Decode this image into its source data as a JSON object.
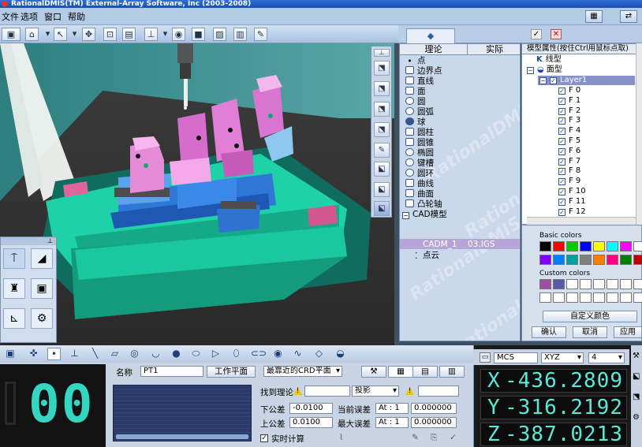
{
  "window": {
    "title": "RationalDMIS(TM) External-Array Software, Inc (2003-2008)"
  },
  "menu": {
    "items": [
      "文件",
      "选项",
      "窗口",
      "帮助"
    ]
  },
  "side_tab": {
    "label": "…"
  },
  "feature_tree": {
    "columns": [
      "理论",
      "实际"
    ],
    "items": [
      {
        "label": "点",
        "icon": "point-icon"
      },
      {
        "label": "边界点",
        "icon": "edge-point-icon"
      },
      {
        "label": "直线",
        "icon": "line-icon"
      },
      {
        "label": "面",
        "icon": "plane-icon"
      },
      {
        "label": "圆",
        "icon": "circle-icon"
      },
      {
        "label": "圆弧",
        "icon": "arc-icon"
      },
      {
        "label": "球",
        "icon": "sphere-icon"
      },
      {
        "label": "圆柱",
        "icon": "cylinder-icon"
      },
      {
        "label": "圆锥",
        "icon": "cone-icon"
      },
      {
        "label": "椭圆",
        "icon": "ellipse-icon"
      },
      {
        "label": "键槽",
        "icon": "slot-icon"
      },
      {
        "label": "圆环",
        "icon": "torus-icon"
      },
      {
        "label": "曲线",
        "icon": "curve-icon"
      },
      {
        "label": "曲面",
        "icon": "surface-icon"
      },
      {
        "label": "凸轮轴",
        "icon": "camshaft-icon"
      },
      {
        "label": "CAD模型",
        "icon": "cad-icon"
      }
    ],
    "cad_entry": {
      "name": "CADM_1",
      "file": "03.IGS"
    },
    "cloud": {
      "label": "点云"
    },
    "watermark": "RationalDMIS"
  },
  "model_panel": {
    "header": "模型属性(按住Ctrl用鼠标点取)",
    "line_type": "线型",
    "surface_type": "面型",
    "layer": "Layer1",
    "faces": [
      "F 0",
      "F 1",
      "F 2",
      "F 3",
      "F 4",
      "F 5",
      "F 6",
      "F 7",
      "F 8",
      "F 9",
      "F 10",
      "F 11",
      "F 12"
    ]
  },
  "colors": {
    "basic_label": "Basic colors",
    "custom_label": "Custom colors",
    "basic": [
      "#000000",
      "#ff0000",
      "#00cc00",
      "#0000ff",
      "#ffff00",
      "#00ffff",
      "#ff00ff",
      "#ffffff",
      "#8000ff",
      "#0080ff",
      "#00a0a0",
      "#808080",
      "#ff8000",
      "#ff0080",
      "#008000",
      "#c00000"
    ],
    "custom": [
      "#9a4fa0",
      "#5a58a8",
      "#ffffff",
      "#ffffff",
      "#ffffff",
      "#ffffff",
      "#ffffff",
      "#ffffff",
      "#ffffff",
      "#ffffff",
      "#ffffff",
      "#ffffff",
      "#ffffff",
      "#ffffff",
      "#ffffff",
      "#ffffff"
    ],
    "define_button": "自定义颜色",
    "ok_button": "确认",
    "cancel_button": "取消",
    "apply_button": "应用"
  },
  "feature_form": {
    "counter": "00",
    "name_label": "名称",
    "name_value": "PT1",
    "workplane_button": "工作平面",
    "plane_select": "最靠近的CRD平面",
    "find_theory_label": "找到理论",
    "projection_select": "投影",
    "lower_tol_label": "下公差",
    "lower_tol_value": "-0.0100",
    "upper_tol_label": "上公差",
    "upper_tol_value": "0.0100",
    "current_err_label": "当前误差",
    "current_err_axis": "At : 1",
    "current_err_value": "0.000000",
    "max_err_label": "最大误差",
    "max_err_axis": "At : 1",
    "max_err_value": "0.000000",
    "realtime_label": "实时计算"
  },
  "coords": {
    "system": "MCS",
    "plane": "XYZ",
    "digits": "4",
    "x_label": "X",
    "x": "-436.2809",
    "y_label": "Y",
    "y": "-316.2192",
    "z_label": "Z",
    "z": "-387.0213"
  }
}
